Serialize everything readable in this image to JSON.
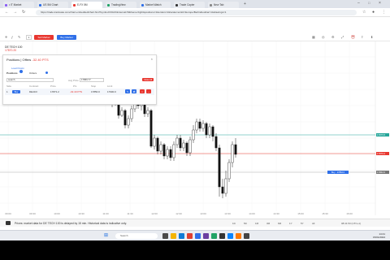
{
  "browser": {
    "tabs": [
      {
        "label": "• IT Market",
        "color": "#8a5cf6"
      },
      {
        "label": "US 5M Chart",
        "color": "#2f6fe8"
      },
      {
        "label": "E-FX 5M",
        "color": "#e8362f"
      },
      {
        "label": "TradingView",
        "color": "#21a366"
      },
      {
        "label": "Market Watch",
        "color": "#2f6fe8"
      },
      {
        "label": "Trade Copier",
        "color": "#333333"
      },
      {
        "label": "New Tab",
        "color": "#888888"
      }
    ],
    "url": "https://trade.tradovate.com/chart-embedded/chart.html?symbol=FDAX&interval=5&theme=light&positions=1&orders=1&locale=en&tz=Europe/Berlin&toolbar=1&drawings=1"
  },
  "toolbar": {
    "sell_label": "Sell Market",
    "buy_label": "Buy Market",
    "qty": "1"
  },
  "symbol": {
    "name": "DE TECH 100",
    "price": "17870.20"
  },
  "positions_panel": {
    "title": "Positions | Offers",
    "pnl": "-32.40 PTS",
    "reload_label": "Load Positn",
    "tab_positions": "Positions",
    "tab_orders": "Orders",
    "search_placeholder": "search",
    "avg_label": "Avg Price",
    "avg_value": "17869.77",
    "close_all_label": "Close All",
    "headers": [
      "Side",
      "Contract",
      "Price",
      "P/L",
      "Stop",
      "Limit"
    ],
    "row": {
      "index": "1",
      "side": "Buy",
      "contract": "DE40.F",
      "price": "17871.2",
      "pnl": "-32.40 PTS",
      "stop": "17850.0",
      "limit": "17900.0"
    }
  },
  "chart_data": {
    "type": "candlestick",
    "price_tags": [
      {
        "label": "17875.5",
        "color": "#26a69a"
      },
      {
        "label": "17870.2",
        "color": "#e8362f"
      },
      {
        "label": "17862.0",
        "color": "#777777"
      }
    ],
    "order_label": "Buy · 17862.0",
    "time_ticks": [
      "09:00",
      "09:30",
      "10:00",
      "10:30",
      "11:00",
      "11:30",
      "12:00",
      "12:30",
      "13:00",
      "13:30",
      "14:00",
      "14:30",
      "15:00",
      "15:30",
      "16:00"
    ]
  },
  "status": {
    "message": "Prices: market data for DE TECH 100 is delayed by 15 min. Historical data is indicative only.",
    "timeframes": [
      "1D",
      "5D",
      "1M",
      "3M",
      "6M",
      "1Y",
      "5Y",
      "All"
    ],
    "right": "08:41:53 (UTC+1)"
  },
  "taskbar": {
    "search_placeholder": "Search",
    "time": "14:41",
    "date": "15/01/2024"
  }
}
